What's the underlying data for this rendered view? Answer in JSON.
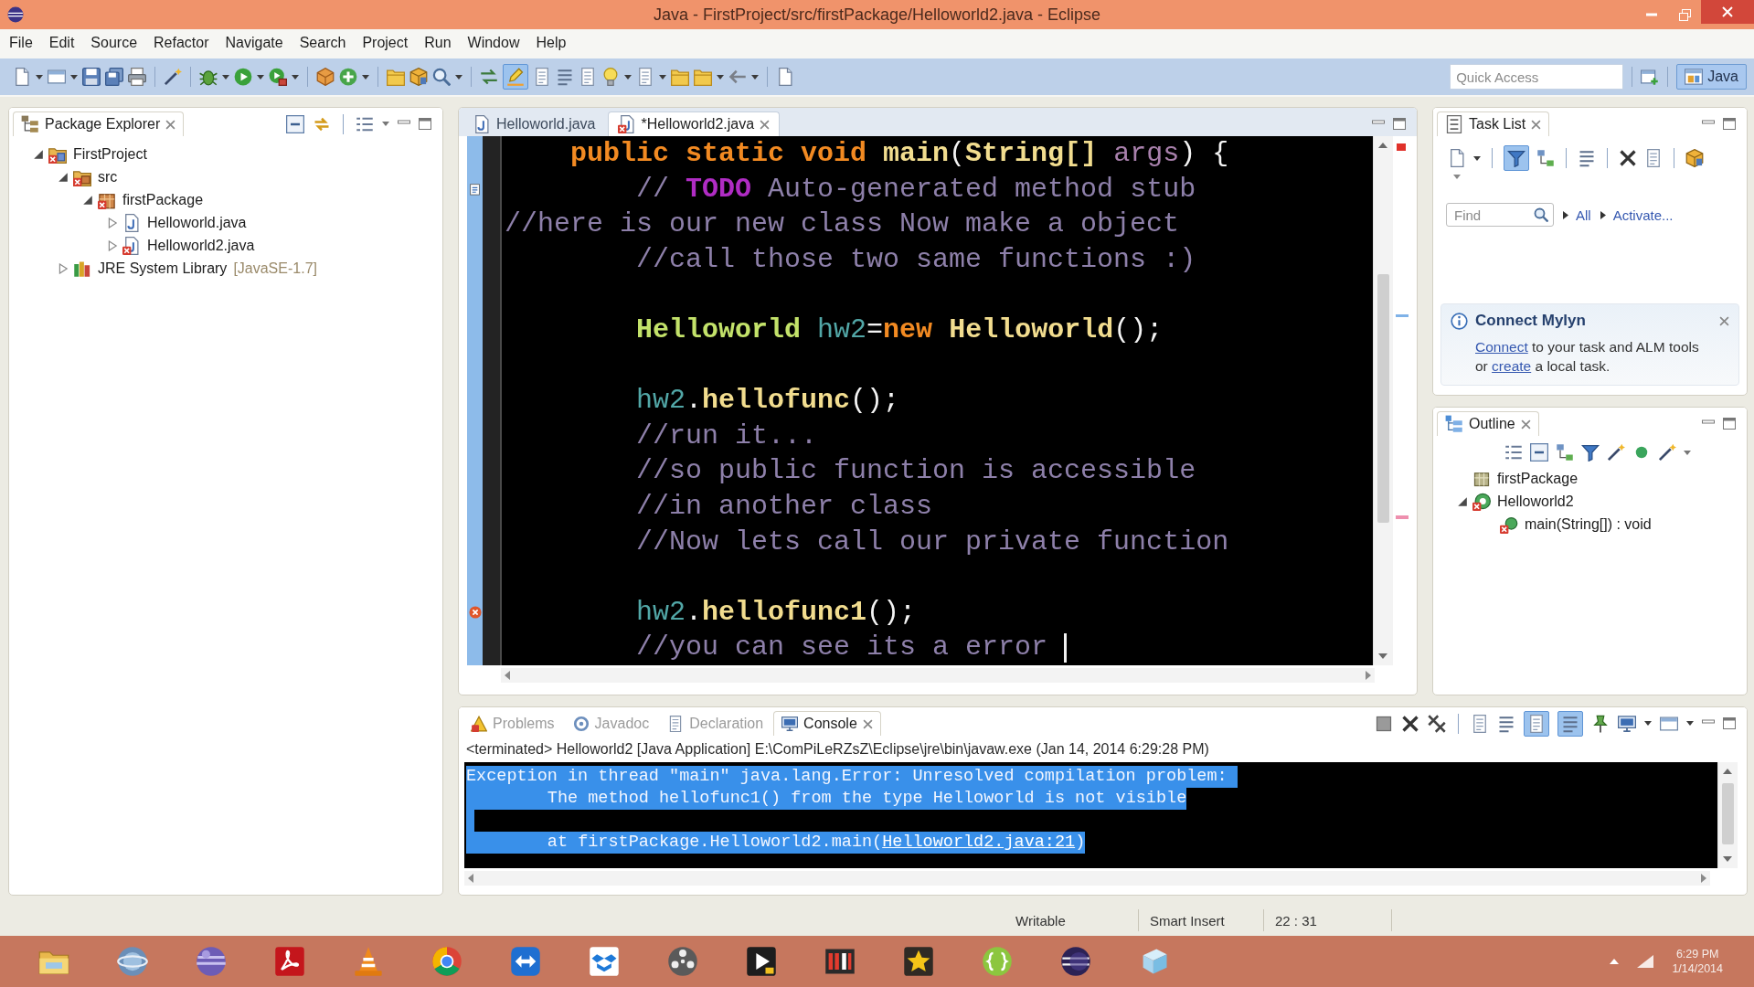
{
  "window": {
    "title": "Java - FirstProject/src/firstPackage/Helloworld2.java - Eclipse"
  },
  "menu": [
    "File",
    "Edit",
    "Source",
    "Refactor",
    "Navigate",
    "Search",
    "Project",
    "Run",
    "Window",
    "Help"
  ],
  "toolbar": {
    "toggles": [
      {
        "pressed": true
      }
    ],
    "quick_access": {
      "placeholder": "Quick Access"
    },
    "perspectives": [
      {
        "label": "Java",
        "selected": true
      }
    ]
  },
  "package_explorer": {
    "title": "Package Explorer",
    "tree": [
      {
        "kind": "project",
        "label": "FirstProject",
        "expanded": true,
        "error": true,
        "children": [
          {
            "kind": "source-folder",
            "label": "src",
            "expanded": true,
            "error": true,
            "children": [
              {
                "kind": "package",
                "label": "firstPackage",
                "expanded": true,
                "error": true,
                "children": [
                  {
                    "kind": "java-file",
                    "label": "Helloworld.java",
                    "expanded": false,
                    "error": false
                  },
                  {
                    "kind": "java-file",
                    "label": "Helloworld2.java",
                    "expanded": false,
                    "error": true
                  }
                ]
              }
            ]
          },
          {
            "kind": "library",
            "label": "JRE System Library",
            "decoration": "[JavaSE-1.7]",
            "expanded": false,
            "error": false
          }
        ]
      }
    ]
  },
  "editor": {
    "tabs": [
      {
        "label": "Helloworld.java",
        "selected": false,
        "error": false
      },
      {
        "label": "*Helloworld2.java",
        "selected": true,
        "error": true
      }
    ],
    "lines": [
      {
        "kind": "code",
        "current": false,
        "tokens": [
          {
            "kind": "keyword",
            "text": "    public static void "
          },
          {
            "kind": "method",
            "text": "main"
          },
          {
            "kind": "plain",
            "text": "("
          },
          {
            "kind": "method",
            "text": "String[] "
          },
          {
            "kind": "param",
            "text": "args"
          },
          {
            "kind": "plain",
            "text": ") {"
          }
        ]
      },
      {
        "kind": "code",
        "current": false,
        "annotation": {
          "kind": "task"
        },
        "tokens": [
          {
            "kind": "comment",
            "text": "        // "
          },
          {
            "kind": "task",
            "text": "TODO"
          },
          {
            "kind": "comment",
            "text": " Auto-generated method stub"
          }
        ]
      },
      {
        "kind": "code",
        "current": false,
        "tokens": [
          {
            "kind": "comment",
            "text": "//here is our new class Now make a object"
          }
        ]
      },
      {
        "kind": "code",
        "current": false,
        "tokens": [
          {
            "kind": "comment",
            "text": "        //call those two same functions :)"
          }
        ]
      },
      {
        "kind": "blank",
        "current": false
      },
      {
        "kind": "code",
        "current": false,
        "tokens": [
          {
            "kind": "type",
            "text": "        Helloworld "
          },
          {
            "kind": "field",
            "text": "hw2"
          },
          {
            "kind": "plain",
            "text": "="
          },
          {
            "kind": "keyword",
            "text": "new "
          },
          {
            "kind": "method",
            "text": "Helloworld"
          },
          {
            "kind": "plain",
            "text": "();"
          }
        ]
      },
      {
        "kind": "blank",
        "current": false
      },
      {
        "kind": "code",
        "current": false,
        "tokens": [
          {
            "kind": "field",
            "text": "        hw2"
          },
          {
            "kind": "plain",
            "text": "."
          },
          {
            "kind": "method",
            "text": "hellofunc"
          },
          {
            "kind": "plain",
            "text": "();"
          }
        ]
      },
      {
        "kind": "code",
        "current": false,
        "tokens": [
          {
            "kind": "comment",
            "text": "        //run it..."
          }
        ]
      },
      {
        "kind": "code",
        "current": false,
        "tokens": [
          {
            "kind": "comment",
            "text": "        //so public function is accessible"
          }
        ]
      },
      {
        "kind": "code",
        "current": false,
        "tokens": [
          {
            "kind": "comment",
            "text": "        //in another class"
          }
        ]
      },
      {
        "kind": "code",
        "current": false,
        "tokens": [
          {
            "kind": "comment",
            "text": "        //Now lets call our private function"
          }
        ]
      },
      {
        "kind": "blank",
        "current": false
      },
      {
        "kind": "code",
        "current": false,
        "annotation": {
          "kind": "error"
        },
        "tokens": [
          {
            "kind": "field",
            "text": "        hw2"
          },
          {
            "kind": "plain",
            "text": "."
          },
          {
            "kind": "method",
            "text": "hellofunc1"
          },
          {
            "kind": "plain",
            "text": "();"
          }
        ]
      },
      {
        "kind": "code",
        "current": true,
        "tokens": [
          {
            "kind": "comment",
            "text": "        //you can see its a error "
          }
        ]
      }
    ]
  },
  "task_list": {
    "title": "Task List",
    "toggles": [
      {
        "pressed": true
      }
    ],
    "find": {
      "placeholder": "Find"
    },
    "links": [
      "All",
      "Activate..."
    ],
    "mylyn": {
      "title": "Connect Mylyn",
      "text": [
        {
          "kind": "link",
          "text": "Connect"
        },
        {
          "kind": "text",
          "text": " to your task and ALM tools or "
        },
        {
          "kind": "link",
          "text": "create"
        },
        {
          "kind": "text",
          "text": " a local task."
        }
      ]
    }
  },
  "outline": {
    "title": "Outline",
    "tree": [
      {
        "kind": "import",
        "label": "firstPackage",
        "error": false
      },
      {
        "kind": "class",
        "label": "Helloworld2",
        "expanded": true,
        "error": true,
        "children": [
          {
            "kind": "method",
            "label": "main(String[]) : void",
            "error": true
          }
        ]
      }
    ]
  },
  "console": {
    "tabs": [
      {
        "kind": "problems",
        "label": "Problems",
        "selected": false
      },
      {
        "kind": "javadoc",
        "label": "Javadoc",
        "selected": false
      },
      {
        "kind": "declaration",
        "label": "Declaration",
        "selected": false
      },
      {
        "kind": "console",
        "label": "Console",
        "selected": true
      }
    ],
    "toggles": [
      {
        "pressed": true
      },
      {
        "pressed": true
      }
    ],
    "header": "<terminated> Helloworld2 [Java Application] E:\\ComPiLeRZsZ\\Eclipse\\jre\\bin\\javaw.exe (Jan 14, 2014 6:29:28 PM)",
    "lines": [
      {
        "kind": "text",
        "selected": true,
        "segments": [
          {
            "kind": "text",
            "text": "Exception in thread \"main\" java.lang.Error: Unresolved compilation problem: "
          }
        ]
      },
      {
        "kind": "text",
        "selected": true,
        "segments": [
          {
            "kind": "text",
            "text": "\tThe method hellofunc1() from the type Helloworld is not visible"
          }
        ]
      },
      {
        "kind": "blank",
        "selected": true
      },
      {
        "kind": "text",
        "selected": true,
        "segments": [
          {
            "kind": "text",
            "text": "\tat firstPackage.Helloworld2.main("
          },
          {
            "kind": "link",
            "text": "Helloworld2.java:21"
          },
          {
            "kind": "text",
            "text": ")"
          }
        ]
      }
    ]
  },
  "status_bar": [
    "Writable",
    "Smart Insert",
    "22 : 31"
  ],
  "taskbar": {
    "time": "6:29 PM",
    "date": "1/14/2014"
  }
}
